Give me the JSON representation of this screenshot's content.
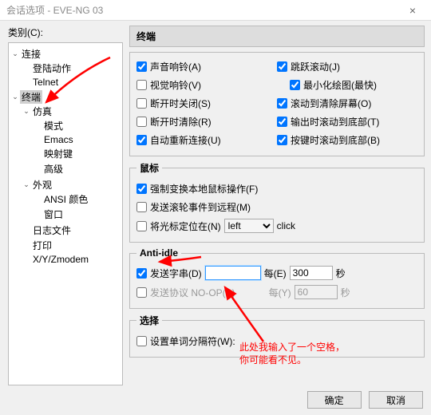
{
  "window": {
    "title": "会话选项 - EVE-NG 03",
    "close": "×"
  },
  "category_label": "类别(C):",
  "tree": {
    "conn": "连接",
    "login": "登陆动作",
    "telnet": "Telnet",
    "term": "终端",
    "emul": "仿真",
    "mode": "模式",
    "emacs": "Emacs",
    "mapkey": "映射键",
    "adv": "高级",
    "appear": "外观",
    "ansi": "ANSI 颜色",
    "win": "窗口",
    "logfile": "日志文件",
    "print": "打印",
    "xyz": "X/Y/Zmodem"
  },
  "section": {
    "terminal": "终端",
    "mouse": "鼠标",
    "antiidle": "Anti-idle",
    "select": "选择"
  },
  "term": {
    "audiobell": "声音响铃(A)",
    "visualbell": "视觉响铃(V)",
    "closeOnDisc": "断开时关闭(S)",
    "clearOnDisc": "断开时清除(R)",
    "autoReconnect": "自动重新连接(U)",
    "jumpScroll": "跳跃滚动(J)",
    "minDraw": "最小化绘图(最快)",
    "scrollClear": "滚动到清除屏幕(O)",
    "scrollBottomOut": "输出时滚动到底部(T)",
    "scrollBottomKey": "按键时滚动到底部(B)"
  },
  "mouse": {
    "forceLocal": "强制变换本地鼠标操作(F)",
    "sendWheel": "发送滚轮事件到远程(M)",
    "posCursor": "将光标定位在(N)",
    "posSel": "left",
    "posAfter": "click"
  },
  "anti": {
    "sendStr": "发送字串(D)",
    "every": "每(E)",
    "strVal": " ",
    "strSec": "300",
    "secLabel": "秒",
    "sendNoop": "发送协议 NO-OP(P)",
    "everyY": "每(Y)",
    "noopSec": "60"
  },
  "sel": {
    "wordDelim": "设置单词分隔符(W):"
  },
  "note": {
    "l1": "此处我输入了一个空格，",
    "l2": "你可能看不见。"
  },
  "btn": {
    "ok": "确定",
    "cancel": "取消"
  }
}
